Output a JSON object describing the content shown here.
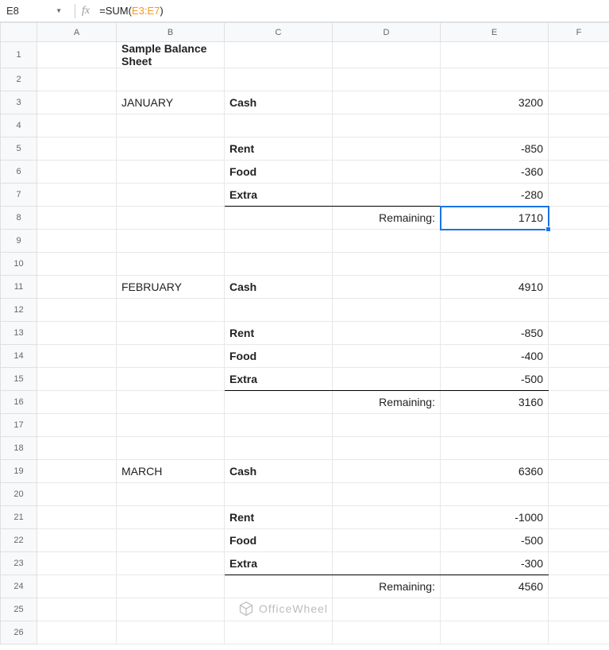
{
  "nameBox": "E8",
  "fxLabel": "fx",
  "formula": {
    "prefix": "=SUM(",
    "ref": "E3:E7",
    "suffix": ")"
  },
  "columns": [
    "A",
    "B",
    "C",
    "D",
    "E",
    "F"
  ],
  "rows": [
    "1",
    "2",
    "3",
    "4",
    "5",
    "6",
    "7",
    "8",
    "9",
    "10",
    "11",
    "12",
    "13",
    "14",
    "15",
    "16",
    "17",
    "18",
    "19",
    "20",
    "21",
    "22",
    "23",
    "24",
    "25",
    "26"
  ],
  "cells": {
    "B1": "Sample Balance Sheet",
    "B3": "JANUARY",
    "C3": "Cash",
    "E3": "3200",
    "C5": "Rent",
    "E5": "-850",
    "C6": "Food",
    "E6": "-360",
    "C7": "Extra",
    "E7": "-280",
    "D8": "Remaining:",
    "E8": "1710",
    "B11": "FEBRUARY",
    "C11": "Cash",
    "E11": "4910",
    "C13": "Rent",
    "E13": "-850",
    "C14": "Food",
    "E14": "-400",
    "C15": "Extra",
    "E15": "-500",
    "D16": "Remaining:",
    "E16": "3160",
    "B19": "MARCH",
    "C19": "Cash",
    "E19": "6360",
    "C21": "Rent",
    "E21": "-1000",
    "C22": "Food",
    "E22": "-500",
    "C23": "Extra",
    "E23": "-300",
    "D24": "Remaining:",
    "E24": "4560"
  },
  "watermark": "OfficeWheel"
}
